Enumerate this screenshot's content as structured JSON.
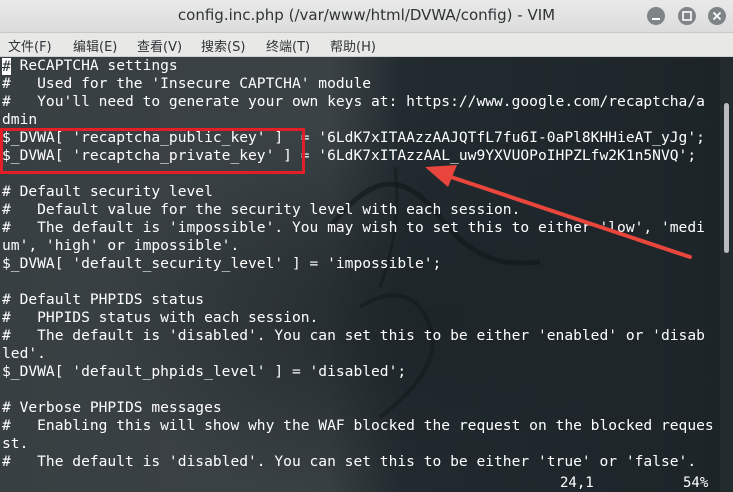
{
  "window": {
    "title": "config.inc.php (/var/www/html/DVWA/config) - VIM",
    "buttons": [
      {
        "name": "minimize",
        "icon": "minimize-icon"
      },
      {
        "name": "maximize",
        "icon": "maximize-icon"
      },
      {
        "name": "close",
        "icon": "close-icon"
      }
    ]
  },
  "menu": {
    "items": [
      {
        "label": "文件(F)"
      },
      {
        "label": "编辑(E)"
      },
      {
        "label": "查看(V)"
      },
      {
        "label": "搜索(S)"
      },
      {
        "label": "终端(T)"
      },
      {
        "label": "帮助(H)"
      }
    ]
  },
  "editor": {
    "lines": [
      "# ReCAPTCHA settings",
      "#   Used for the 'Insecure CAPTCHA' module",
      "#   You'll need to generate your own keys at: https://www.google.com/recaptcha/a",
      "dmin",
      "$_DVWA[ 'recaptcha_public_key' ]  = '6LdK7xITAAzzAAJQTfL7fu6I-0aPl8KHHieAT_yJg';",
      "$_DVWA[ 'recaptcha_private_key' ] = '6LdK7xITAzzAAL_uw9YXVUOPoIHPZLfw2K1n5NVQ';",
      "",
      "# Default security level",
      "#   Default value for the security level with each session.",
      "#   The default is 'impossible'. You may wish to set this to either 'low', 'medi",
      "um', 'high' or impossible'.",
      "$_DVWA[ 'default_security_level' ] = 'impossible';",
      "",
      "# Default PHPIDS status",
      "#   PHPIDS status with each session.",
      "#   The default is 'disabled'. You can set this to be either 'enabled' or 'disab",
      "led'.",
      "$_DVWA[ 'default_phpids_level' ] = 'disabled';",
      "",
      "# Verbose PHPIDS messages",
      "#   Enabling this will show why the WAF blocked the request on the blocked reques",
      "st.",
      "#   The default is 'disabled'. You can set this to be either 'true' or 'false'."
    ],
    "status": {
      "position": "24,1",
      "percent": "54%"
    },
    "scroll_fraction": 0.54
  },
  "colors": {
    "text": "#ffffff",
    "highlight_box": "#e21f26",
    "arrow": "#e8453c",
    "titlebar": "#e3e3e3",
    "terminal_bg": "#2b3438"
  }
}
